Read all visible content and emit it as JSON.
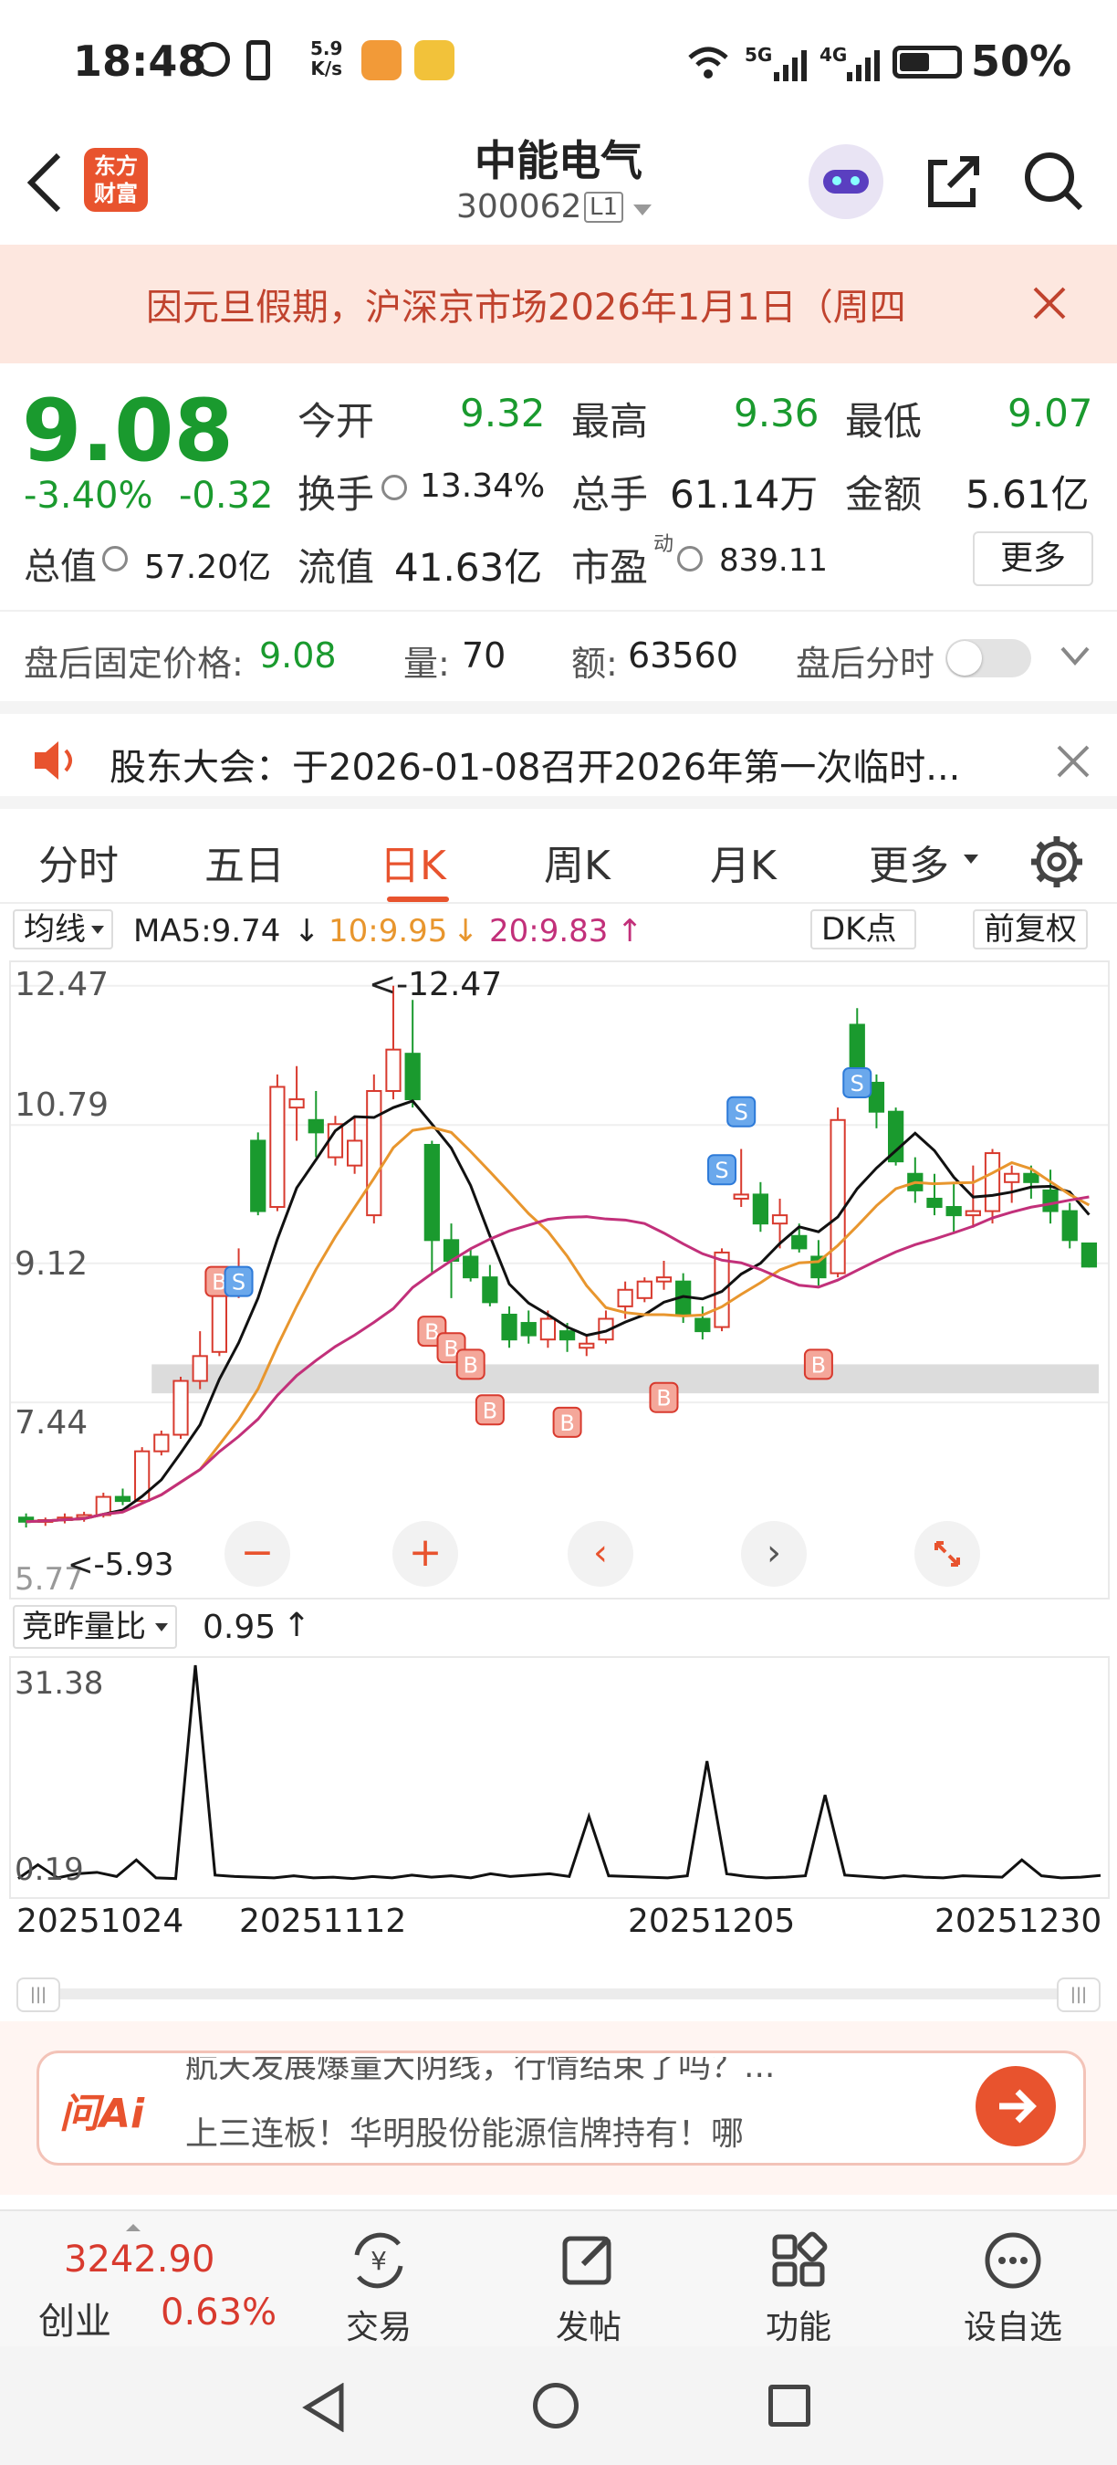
{
  "status_bar": {
    "time": "18:48",
    "net_speed_top": "5.9",
    "net_speed_unit": "K/s",
    "sig1": "5G",
    "sig2": "4G",
    "battery": "50%"
  },
  "header": {
    "logo_line1": "东方",
    "logo_line2": "财富",
    "stock_name": "中能电气",
    "stock_code": "300062",
    "level": "L1"
  },
  "notice": {
    "text": "因元旦假期，沪深京市场2026年1月1日（周四"
  },
  "quote": {
    "price": "9.08",
    "change_pct": "-3.40%",
    "change": "-0.32",
    "open_label": "今开",
    "open": "9.32",
    "high_label": "最高",
    "high": "9.36",
    "low_label": "最低",
    "low": "9.07",
    "turnover_label": "换手",
    "turnover": "13.34%",
    "volume_label": "总手",
    "volume": "61.14万",
    "amount_label": "金额",
    "amount": "5.61亿",
    "mcap_label": "总值",
    "mcap": "57.20亿",
    "float_label": "流值",
    "float": "41.63亿",
    "pe_label": "市盈",
    "pe_sup": "动",
    "pe": "839.11",
    "more_btn": "更多"
  },
  "after_hours": {
    "price_label": "盘后固定价格:",
    "price": "9.08",
    "vol_label": "量:",
    "vol": "70",
    "amt_label": "额:",
    "amt": "63560",
    "timeshare_label": "盘后分时"
  },
  "meeting": {
    "text": "股东大会：于2026-01-08召开2026年第一次临时..."
  },
  "tabs": [
    "分时",
    "五日",
    "日K",
    "周K",
    "月K",
    "更多"
  ],
  "indicator": {
    "selector": "均线",
    "ma5": "MA5:9.74",
    "ma10": "10:9.95",
    "ma20": "20:9.83",
    "dk_btn": "DK点",
    "adjust_btn": "前复权"
  },
  "chart_data": {
    "type": "candlestick",
    "y_ticks": [
      "12.47",
      "10.79",
      "9.12",
      "7.44"
    ],
    "y_bottom_label": "5.77",
    "max_label": "<-12.47",
    "min_label": "<-5.93",
    "colors": {
      "up": "#d83a2e",
      "down": "#1a9a2e",
      "ma5": "#111111",
      "ma10": "#e8962e",
      "ma20": "#c2307a"
    },
    "ohlc": [
      [
        6.05,
        6.1,
        5.93,
        6.0
      ],
      [
        6.0,
        6.05,
        5.95,
        6.02
      ],
      [
        6.02,
        6.1,
        5.98,
        6.05
      ],
      [
        6.05,
        6.12,
        6.0,
        6.08
      ],
      [
        6.08,
        6.35,
        6.05,
        6.3
      ],
      [
        6.3,
        6.4,
        6.2,
        6.25
      ],
      [
        6.25,
        6.9,
        6.22,
        6.85
      ],
      [
        6.85,
        7.1,
        6.8,
        7.05
      ],
      [
        7.05,
        7.75,
        7.0,
        7.7
      ],
      [
        7.7,
        8.3,
        7.6,
        8.0
      ],
      [
        8.05,
        9.05,
        8.0,
        9.0
      ],
      [
        9.0,
        9.3,
        8.7,
        9.05
      ],
      [
        10.6,
        10.7,
        9.7,
        9.75
      ],
      [
        9.8,
        11.4,
        9.75,
        11.25
      ],
      [
        11.0,
        11.5,
        10.6,
        11.1
      ],
      [
        10.85,
        11.2,
        10.4,
        10.7
      ],
      [
        10.4,
        10.9,
        10.3,
        10.8
      ],
      [
        10.3,
        10.9,
        10.2,
        10.6
      ],
      [
        9.7,
        11.4,
        9.6,
        11.2
      ],
      [
        11.2,
        12.47,
        11.1,
        11.7
      ],
      [
        11.65,
        12.3,
        11.0,
        11.1
      ],
      [
        10.55,
        10.6,
        9.0,
        9.4
      ],
      [
        9.4,
        9.6,
        8.7,
        9.15
      ],
      [
        9.2,
        9.3,
        8.9,
        8.95
      ],
      [
        8.95,
        9.1,
        8.6,
        8.65
      ],
      [
        8.5,
        8.6,
        8.1,
        8.2
      ],
      [
        8.4,
        8.55,
        8.15,
        8.25
      ],
      [
        8.2,
        8.55,
        8.1,
        8.45
      ],
      [
        8.3,
        8.4,
        8.05,
        8.2
      ],
      [
        8.1,
        8.25,
        8.0,
        8.15
      ],
      [
        8.2,
        8.55,
        8.15,
        8.45
      ],
      [
        8.6,
        8.9,
        8.45,
        8.8
      ],
      [
        8.7,
        8.95,
        8.65,
        8.9
      ],
      [
        8.9,
        9.15,
        8.8,
        8.95
      ],
      [
        8.9,
        9.0,
        8.4,
        8.5
      ],
      [
        8.45,
        8.6,
        8.2,
        8.3
      ],
      [
        8.35,
        9.3,
        8.3,
        9.25
      ],
      [
        9.9,
        10.5,
        9.8,
        9.95
      ],
      [
        9.95,
        10.1,
        9.5,
        9.6
      ],
      [
        9.6,
        9.9,
        9.3,
        9.7
      ],
      [
        9.45,
        9.6,
        9.25,
        9.3
      ],
      [
        9.2,
        9.4,
        8.85,
        8.95
      ],
      [
        9.0,
        11.0,
        8.95,
        10.85
      ],
      [
        12.0,
        12.2,
        11.2,
        11.3
      ],
      [
        11.3,
        11.4,
        10.75,
        10.95
      ],
      [
        10.95,
        11.0,
        10.3,
        10.35
      ],
      [
        10.2,
        10.4,
        9.85,
        10.0
      ],
      [
        9.9,
        10.2,
        9.7,
        9.8
      ],
      [
        9.8,
        10.1,
        9.5,
        9.7
      ],
      [
        9.7,
        10.3,
        9.55,
        9.75
      ],
      [
        9.75,
        10.5,
        9.6,
        10.45
      ],
      [
        10.1,
        10.3,
        9.85,
        10.2
      ],
      [
        10.2,
        10.3,
        9.9,
        10.1
      ],
      [
        10.0,
        10.25,
        9.6,
        9.75
      ],
      [
        9.75,
        9.85,
        9.3,
        9.4
      ],
      [
        9.36,
        9.36,
        9.07,
        9.08
      ]
    ]
  },
  "volume": {
    "selector": "竞昨量比",
    "value": "0.95",
    "y_top": "31.38",
    "y_bottom": "0.19"
  },
  "dates": [
    "20251024",
    "20251112",
    "20251205",
    "20251230"
  ],
  "ai_bar": {
    "logo": "问Ai",
    "line1": "航天发展爆量大阴线，行情结束了吗？...",
    "line2": "上三连板！华明股份能源信牌持有！哪"
  },
  "bottom_nav": {
    "index_value": "3242.90",
    "index_name": "创业",
    "index_pct": "0.63%",
    "items": [
      "交易",
      "发帖",
      "功能",
      "设自选"
    ]
  }
}
